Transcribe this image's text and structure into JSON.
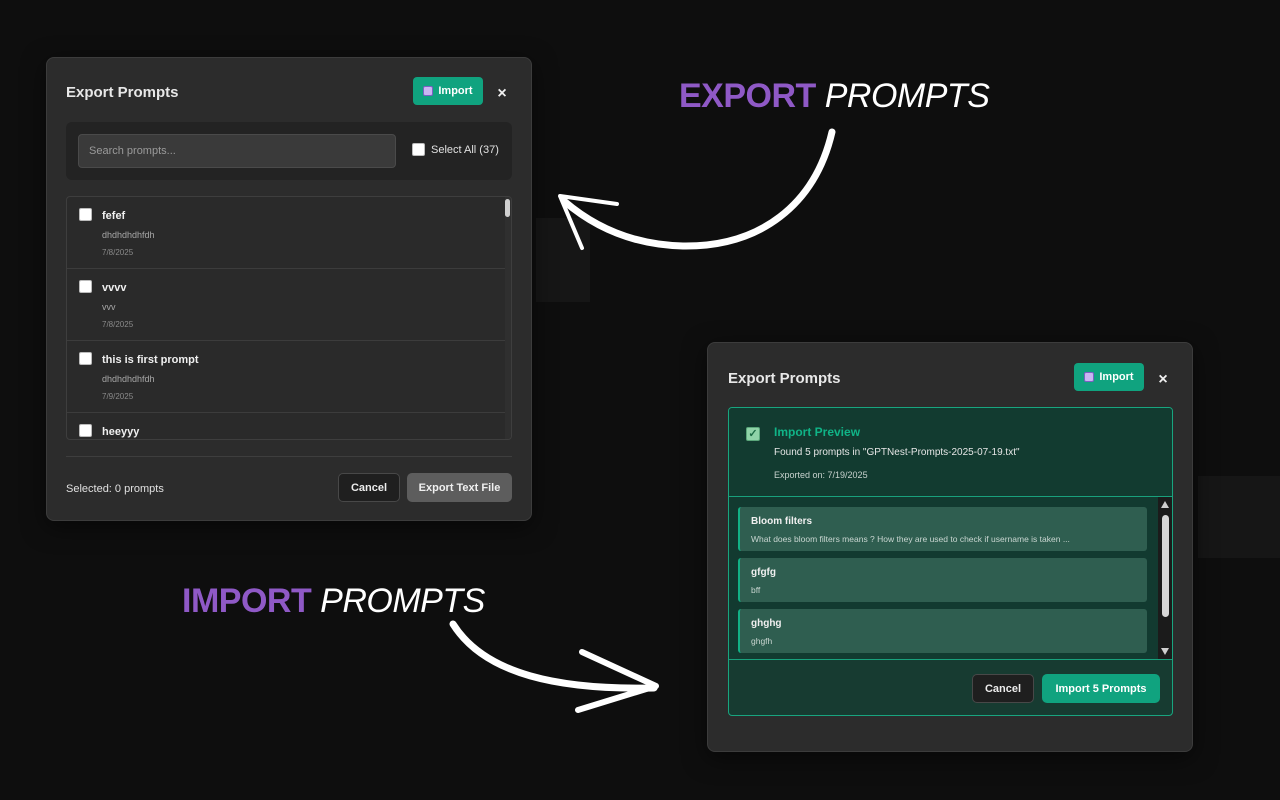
{
  "export_caption": {
    "strong": "EXPORT",
    "light": " PROMPTS"
  },
  "import_caption": {
    "strong": "IMPORT",
    "light": " PROMPTS"
  },
  "export_dialog": {
    "title": "Export Prompts",
    "import_button": "Import",
    "import_button_icon": "import-icon",
    "close": "×",
    "search_placeholder": "Search prompts...",
    "select_all": "Select All (37)",
    "items": [
      {
        "title": "fefef",
        "desc": "dhdhdhdhfdh",
        "date": "7/8/2025"
      },
      {
        "title": "vvvv",
        "desc": "vvv",
        "date": "7/8/2025"
      },
      {
        "title": "this is first prompt",
        "desc": "dhdhdhdhfdh",
        "date": "7/9/2025"
      },
      {
        "title": "heeyyy",
        "desc": "",
        "date": ""
      }
    ],
    "selected_count": "Selected: 0 prompts",
    "cancel": "Cancel",
    "export_button": "Export Text File"
  },
  "import_dialog": {
    "title": "Export Prompts",
    "import_button": "Import",
    "import_button_icon": "import-icon",
    "close": "×",
    "preview": {
      "title": "Import Preview",
      "found": "Found 5 prompts in \"GPTNest-Prompts-2025-07-19.txt\"",
      "exported_on": "Exported on: 7/19/2025",
      "items": [
        {
          "title": "Bloom filters",
          "desc": "What does bloom filters means ? How they are used to check if username is taken ..."
        },
        {
          "title": "gfgfg",
          "desc": "bff"
        },
        {
          "title": "ghghg",
          "desc": "ghgfh"
        }
      ]
    },
    "cancel": "Cancel",
    "import_n_button": "Import 5 Prompts"
  },
  "colors": {
    "background": "#0e0e0e",
    "dialog": "#2c2c2c",
    "accent_green": "#10a37f",
    "caption_purple": "#8f59c6"
  }
}
